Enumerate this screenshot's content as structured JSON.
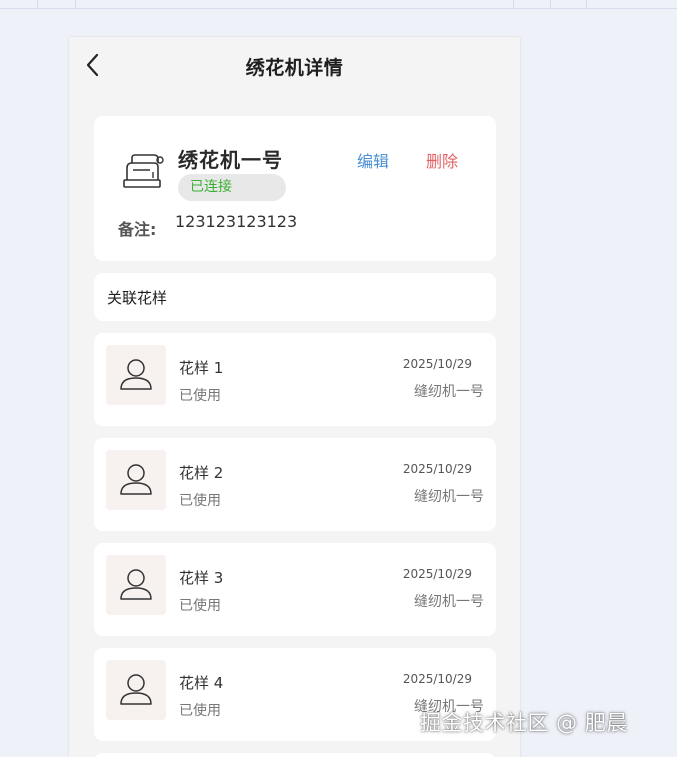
{
  "nav": {
    "title": "绣花机详情"
  },
  "device": {
    "name": "绣花机一号",
    "status": "已连接",
    "edit_label": "编辑",
    "delete_label": "删除",
    "remark_label": "备注:",
    "remark_value": "123123123123"
  },
  "section": {
    "title": "关联花样"
  },
  "patterns": [
    {
      "name": "花样 1",
      "status": "已使用",
      "date": "2025/10/29",
      "machine": "缝纫机一号"
    },
    {
      "name": "花样 2",
      "status": "已使用",
      "date": "2025/10/29",
      "machine": "缝纫机一号"
    },
    {
      "name": "花样 3",
      "status": "已使用",
      "date": "2025/10/29",
      "machine": "缝纫机一号"
    },
    {
      "name": "花样 4",
      "status": "已使用",
      "date": "2025/10/29",
      "machine": "缝纫机一号"
    }
  ],
  "watermark": "掘金技术社区 @ 肥晨",
  "colors": {
    "status_green": "#3cae34",
    "edit_blue": "#4a8fd6",
    "delete_red": "#e26262"
  },
  "icons": {
    "back": "chevron-left-icon",
    "machine": "sewing-machine-icon",
    "thumb": "user-avatar-icon"
  }
}
